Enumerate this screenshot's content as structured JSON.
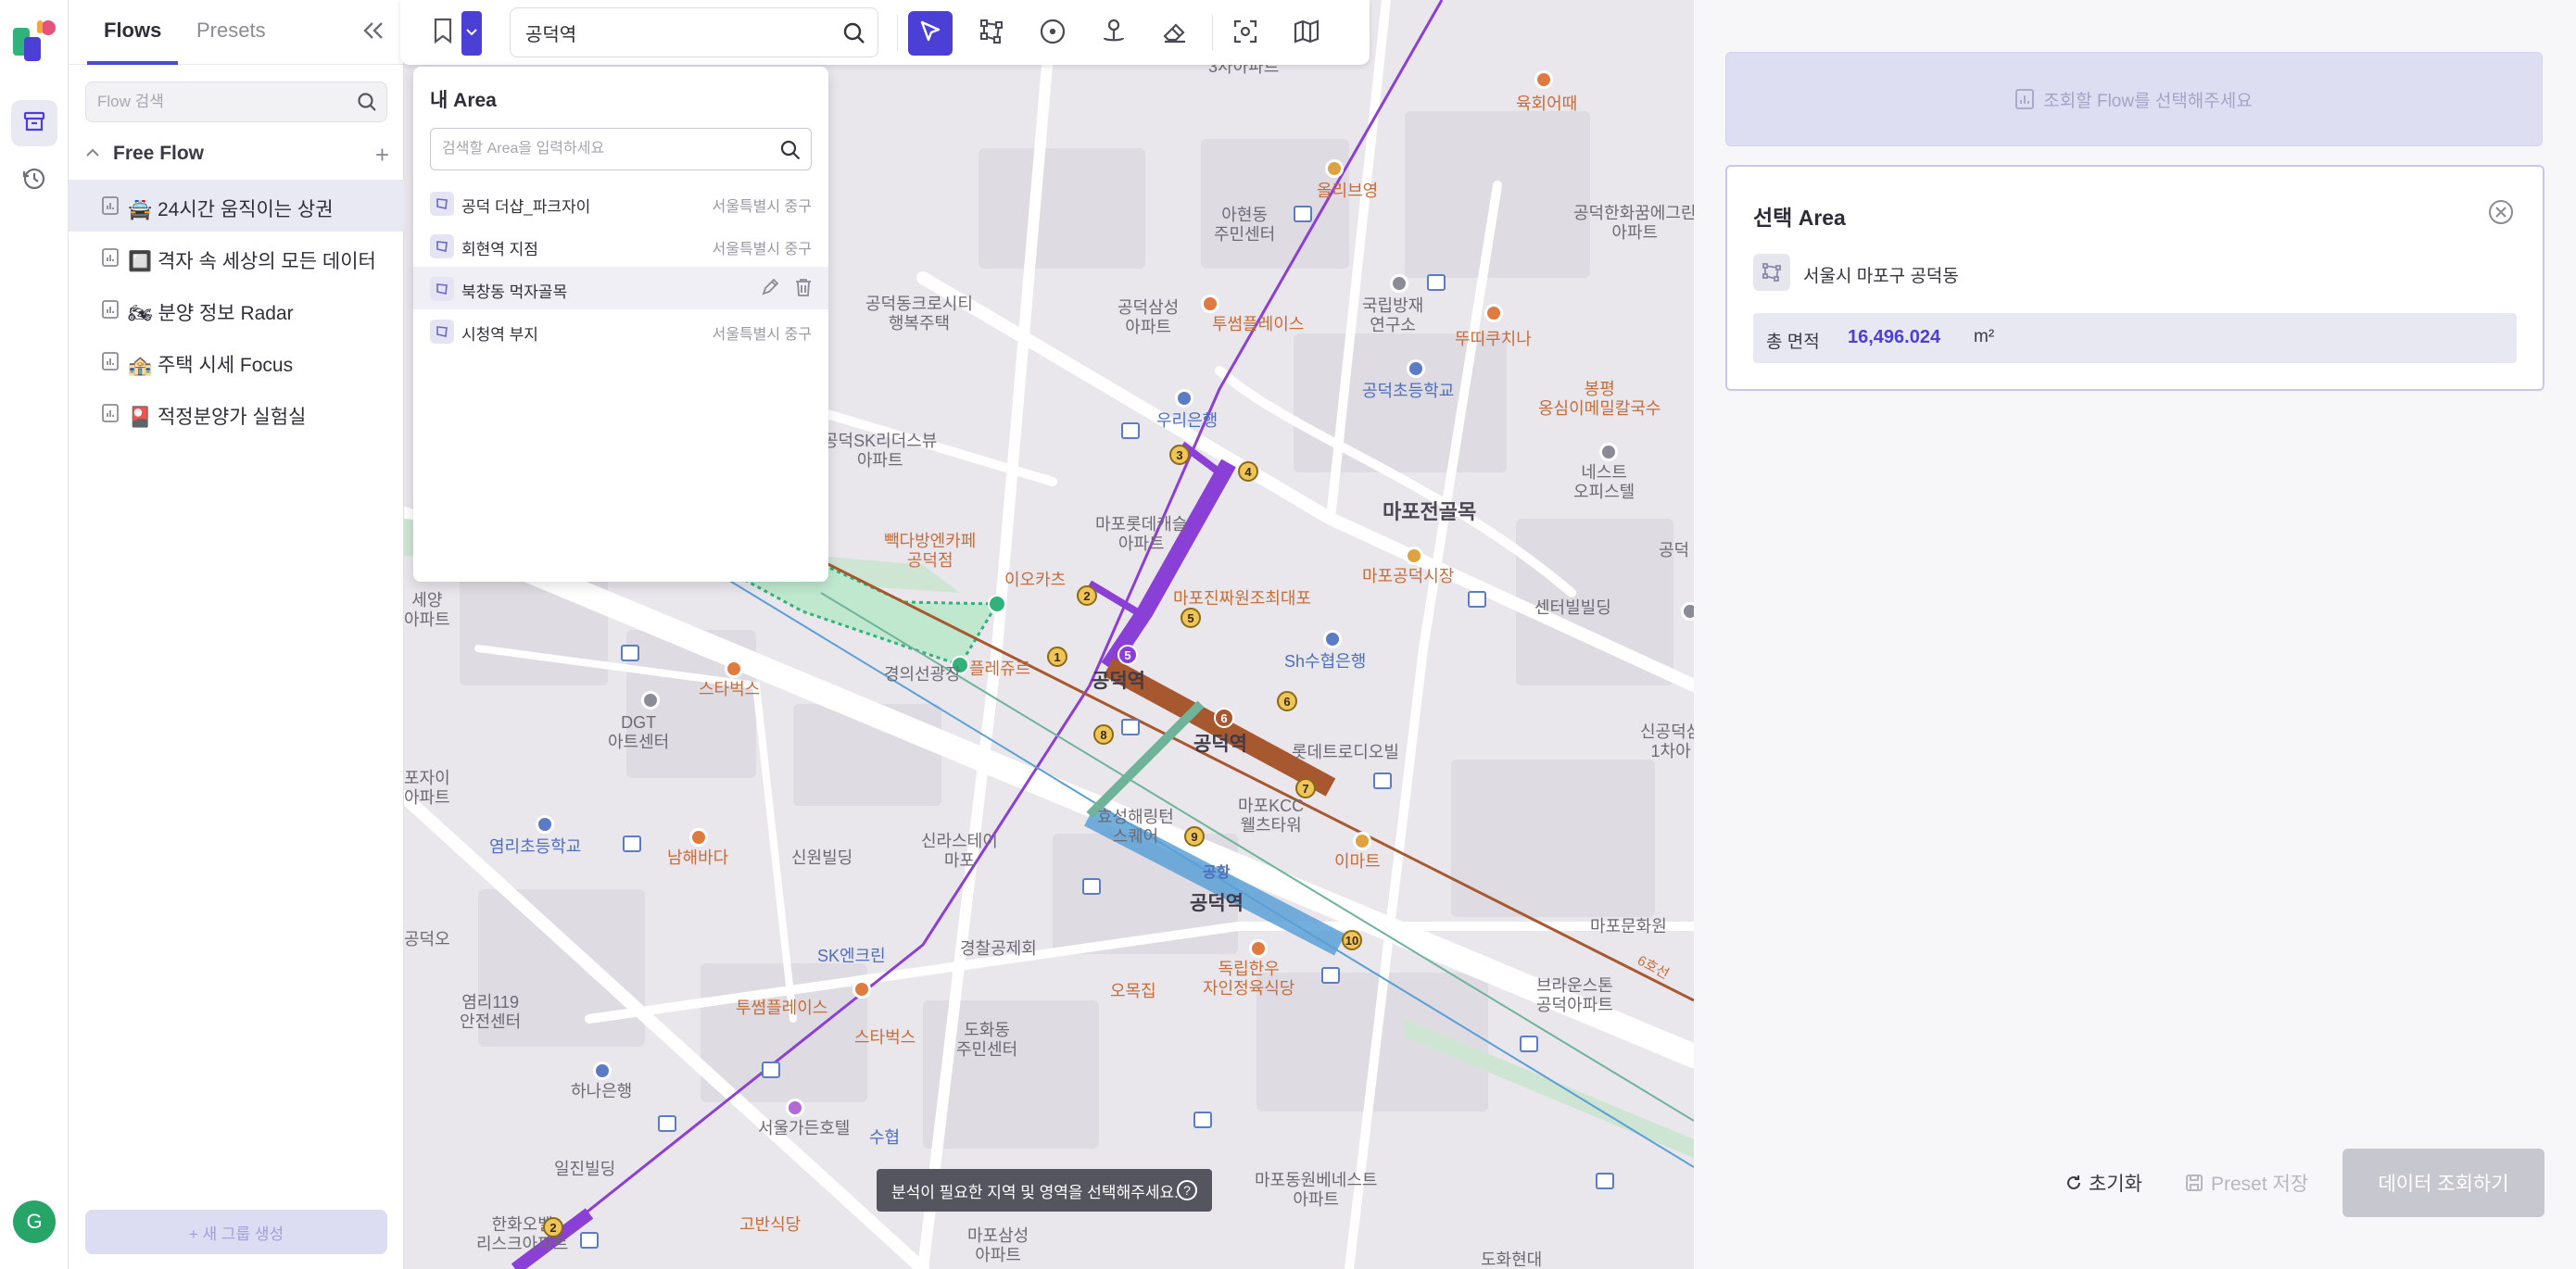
{
  "sidebar": {
    "tabs": [
      {
        "label": "Flows"
      },
      {
        "label": "Presets"
      }
    ],
    "search_placeholder": "Flow 검색",
    "group_title": "Free Flow",
    "group_add": "+",
    "flows": [
      {
        "label": "🚔 24시간 움직이는 상권"
      },
      {
        "label": "🔲 격자 속 세상의 모든 데이터"
      },
      {
        "label": "🏍 분양 정보 Radar"
      },
      {
        "label": "🏤 주택 시세 Focus"
      },
      {
        "label": "🎴 적정분양가 실험실"
      }
    ],
    "new_group_label": "+ 새 그룹 생성"
  },
  "rail": {
    "avatar_initial": "G"
  },
  "toolbar": {
    "search_value": "공덕역"
  },
  "area_panel": {
    "title": "내 Area",
    "search_placeholder": "검색할 Area을 입력하세요",
    "items": [
      {
        "name": "공덕 더샵_파크자이",
        "region": "서울특별시 중구"
      },
      {
        "name": "회현역 지점",
        "region": "서울특별시 중구"
      },
      {
        "name": "북창동 먹자골목",
        "region": ""
      },
      {
        "name": "시청역 부지",
        "region": "서울특별시 중구"
      }
    ]
  },
  "map": {
    "hint": "분석이 필요한 지역 및 영역을 선택해주세요.",
    "hint_q": "?",
    "labels": [
      {
        "text": "3차아파트"
      },
      {
        "text": "육회어때"
      },
      {
        "text": "올리브영"
      },
      {
        "text": "아현동\n주민센터"
      },
      {
        "text": "공덕한화꿈에그린\n아파트"
      },
      {
        "text": "공덕동크로시티\n행복주택"
      },
      {
        "text": "공덕삼성\n아파트"
      },
      {
        "text": "투썸플레이스"
      },
      {
        "text": "국립방재\n연구소"
      },
      {
        "text": "뚜띠쿠치나"
      },
      {
        "text": "공덕초등학교"
      },
      {
        "text": "봉평\n옹심이메밀칼국수"
      },
      {
        "text": "우리은행"
      },
      {
        "text": "공덕SK리더스뷰\n아파트"
      },
      {
        "text": "네스트\n오피스텔"
      },
      {
        "text": "마포전골목"
      },
      {
        "text": "마포롯데캐슬\n아파트"
      },
      {
        "text": "빽다방엔카페\n공덕점"
      },
      {
        "text": "이오카츠"
      },
      {
        "text": "마포진짜원조최대포"
      },
      {
        "text": "마포공덕시장"
      },
      {
        "text": "센터빌빌딩"
      },
      {
        "text": "세양\n아파트"
      },
      {
        "text": "플레쥬르"
      },
      {
        "text": "Sh수협은행"
      },
      {
        "text": "스타벅스"
      },
      {
        "text": "경의선광장"
      },
      {
        "text": "공덕역"
      },
      {
        "text": "공덕역"
      },
      {
        "text": "롯데트로디오빌"
      },
      {
        "text": "DGT\n아트센터"
      },
      {
        "text": "신공덕삼\n1차아"
      },
      {
        "text": "마포KCC\n웰츠타워"
      },
      {
        "text": "이마트"
      },
      {
        "text": "포자이\n아파트"
      },
      {
        "text": "효성해링턴\n스퀘어"
      },
      {
        "text": "신라스테이\n마포"
      },
      {
        "text": "공덕역"
      },
      {
        "text": "염리초등학교"
      },
      {
        "text": "남해바다"
      },
      {
        "text": "신원빌딩"
      },
      {
        "text": "SK엔크린"
      },
      {
        "text": "경찰공제회"
      },
      {
        "text": "독립한우\n자인정육식당"
      },
      {
        "text": "마포문화원"
      },
      {
        "text": "오목집"
      },
      {
        "text": "브라운스톤\n공덕아파트"
      },
      {
        "text": "염리119\n안전센터"
      },
      {
        "text": "투썸플레이스"
      },
      {
        "text": "스타벅스"
      },
      {
        "text": "도화동\n주민센터"
      },
      {
        "text": "하나은행"
      },
      {
        "text": "서울가든호텔"
      },
      {
        "text": "수협"
      },
      {
        "text": "일진빌딩"
      },
      {
        "text": "마포동원베네스트\n아파트"
      },
      {
        "text": "한화오벨\n리스크아파트"
      },
      {
        "text": "고반식당"
      },
      {
        "text": "마포삼성\n아파트"
      },
      {
        "text": "도화현대"
      },
      {
        "text": "공덕"
      },
      {
        "text": "공항"
      },
      {
        "text": "6호선"
      },
      {
        "text": "공덕오"
      }
    ],
    "exits": [
      "3",
      "4",
      "2",
      "5",
      "1",
      "5",
      "6",
      "8",
      "7",
      "9",
      "10",
      "2",
      "6"
    ]
  },
  "right_panel": {
    "flow_prompt": "조회할 Flow를 선택해주세요",
    "selected_title": "선택 Area",
    "selected_area_name": "서울시 마포구 공덕동",
    "stat_label": "총 면적",
    "stat_value": "16,496.024",
    "stat_unit": "m²",
    "reset_label": "초기화",
    "preset_label": "Preset 저장",
    "fetch_label": "데이터 조회하기"
  },
  "colors": {
    "accent": "#4b3fd6",
    "line5": "#8a3fd6",
    "line6": "#a8582f",
    "airport": "#5aa0d6",
    "gyeongui": "#6fb39a",
    "selection": "#2fb37a"
  },
  "icons": {
    "logo": "flow-logo-icon",
    "history": "clock-icon",
    "flows": "archive-icon",
    "search": "search-icon",
    "bookmark": "bookmark-icon",
    "pointer": "cursor-icon",
    "polygon": "polygon-icon",
    "circle": "circle-icon",
    "pin": "pin-icon",
    "eraser": "eraser-icon",
    "capture": "capture-icon",
    "map": "map-icon"
  }
}
